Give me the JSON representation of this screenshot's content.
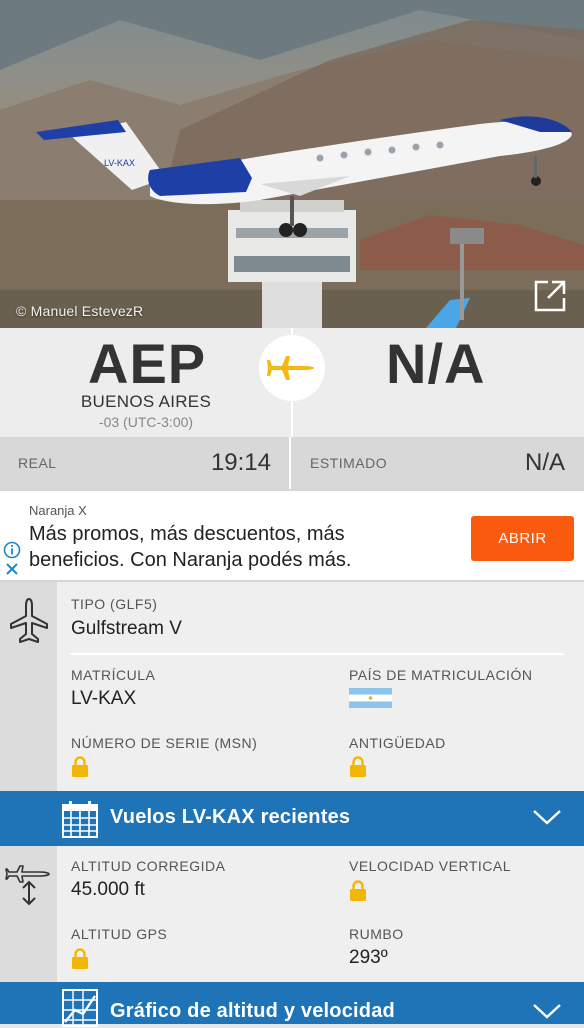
{
  "photo": {
    "credit": "© Manuel EstevezR",
    "registration_on_tail": "LV-KAX"
  },
  "route": {
    "origin_code": "AEP",
    "origin_city": "BUENOS AIRES",
    "origin_timezone": "-03 (UTC-3:00)",
    "destination_code": "N/A"
  },
  "times": {
    "actual_label": "REAL",
    "actual_value": "19:14",
    "estimated_label": "ESTIMADO",
    "estimated_value": "N/A"
  },
  "ad": {
    "advertiser": "Naranja X",
    "headline_line1": "Más promos, más descuentos, más",
    "headline_line2": "beneficios. Con Naranja podés más.",
    "cta": "ABRIR"
  },
  "aircraft": {
    "type_label": "TIPO (GLF5)",
    "type_value": "Gulfstream V",
    "registration_label": "MATRÍCULA",
    "registration_value": "LV-KAX",
    "country_label": "PAÍS DE MATRICULACIÓN",
    "serial_label": "NÚMERO DE SERIE (MSN)",
    "age_label": "ANTIGÜEDAD"
  },
  "recent_flights_bar": {
    "title": "Vuelos LV-KAX recientes"
  },
  "altitude": {
    "calibrated_label": "ALTITUD CORREGIDA",
    "calibrated_value": "45.000 ft",
    "vertical_speed_label": "VELOCIDAD VERTICAL",
    "gps_label": "ALTITUD GPS",
    "heading_label": "RUMBO",
    "heading_value": "293º"
  },
  "chart_bar": {
    "title": "Gráfico de altitud y velocidad"
  },
  "colors": {
    "accent_blue": "#1f74b8",
    "plane_yellow": "#f5b812",
    "cta_orange": "#f95a0e",
    "lock_yellow": "#f2b705"
  }
}
